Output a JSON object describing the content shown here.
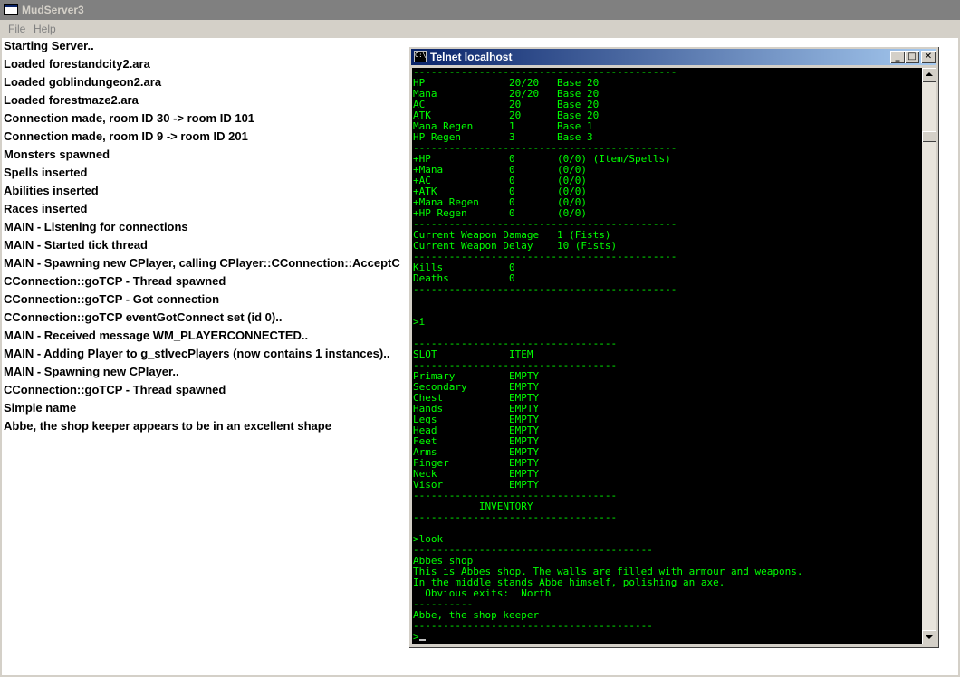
{
  "main_window": {
    "title": "MudServer3",
    "menu": [
      "File",
      "Help"
    ],
    "log_lines": [
      "Starting Server..",
      "Loaded forestandcity2.ara",
      "Loaded goblindungeon2.ara",
      "Loaded forestmaze2.ara",
      "Connection made, room ID 30 -> room ID 101",
      "Connection made, room ID 9 -> room ID 201",
      "Monsters spawned",
      "Spells inserted",
      "Abilities inserted",
      "Races inserted",
      "MAIN - Listening for connections",
      "MAIN - Started tick thread",
      "MAIN - Spawning new CPlayer, calling CPlayer::CConnection::AcceptC",
      "CConnection::goTCP - Thread spawned",
      "CConnection::goTCP - Got connection",
      "CConnection::goTCP eventGotConnect set (id 0)..",
      "MAIN - Received message WM_PLAYERCONNECTED..",
      "MAIN - Adding Player to g_stlvecPlayers (now contains 1 instances)..",
      "MAIN - Spawning new CPlayer..",
      "CConnection::goTCP - Thread spawned",
      "Simple name",
      "Abbe, the shop keeper appears to be in an excellent shape"
    ]
  },
  "telnet_window": {
    "title": "Telnet localhost",
    "icon_label": "C:\\",
    "buttons": {
      "minimize": "_",
      "maximize": "□",
      "close": "✕"
    },
    "console_lines": [
      "--------------------------------------------",
      "HP              20/20   Base 20",
      "Mana            20/20   Base 20",
      "AC              20      Base 20",
      "ATK             20      Base 20",
      "Mana Regen      1       Base 1",
      "HP Regen        3       Base 3",
      "--------------------------------------------",
      "+HP             0       (0/0) (Item/Spells)",
      "+Mana           0       (0/0)",
      "+AC             0       (0/0)",
      "+ATK            0       (0/0)",
      "+Mana Regen     0       (0/0)",
      "+HP Regen       0       (0/0)",
      "--------------------------------------------",
      "Current Weapon Damage   1 (Fists)",
      "Current Weapon Delay    10 (Fists)",
      "--------------------------------------------",
      "Kills           0",
      "Deaths          0",
      "--------------------------------------------",
      "",
      "",
      ">i",
      "",
      "----------------------------------",
      "SLOT            ITEM",
      "----------------------------------",
      "Primary         EMPTY",
      "Secondary       EMPTY",
      "Chest           EMPTY",
      "Hands           EMPTY",
      "Legs            EMPTY",
      "Head            EMPTY",
      "Feet            EMPTY",
      "Arms            EMPTY",
      "Finger          EMPTY",
      "Neck            EMPTY",
      "Visor           EMPTY",
      "----------------------------------",
      "           INVENTORY",
      "----------------------------------",
      "",
      ">look",
      "----------------------------------------",
      "Abbes shop",
      "This is Abbes shop. The walls are filled with armour and weapons.",
      "In the middle stands Abbe himself, polishing an axe.",
      "  Obvious exits:  North",
      "----------",
      "Abbe, the shop keeper",
      "----------------------------------------",
      ">"
    ]
  },
  "colors": {
    "console_text": "#00ff00",
    "console_bg": "#000000",
    "title_active_start": "#0a246a",
    "title_active_end": "#a6caf0",
    "title_inactive": "#808080"
  }
}
